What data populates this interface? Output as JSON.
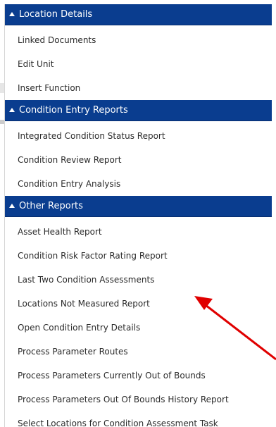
{
  "menu": {
    "sections": [
      {
        "title": "Location Details",
        "items": [
          "Linked Documents",
          "Edit Unit",
          "Insert Function"
        ]
      },
      {
        "title": "Condition Entry Reports",
        "items": [
          "Integrated Condition Status Report",
          "Condition Review Report",
          "Condition Entry Analysis"
        ]
      },
      {
        "title": "Other Reports",
        "items": [
          "Asset Health Report",
          "Condition Risk Factor Rating Report",
          "Last Two Condition Assessments",
          "Locations Not Measured Report",
          "Open Condition Entry Details",
          "Process Parameter Routes",
          "Process Parameters Currently Out of Bounds",
          "Process Parameters Out Of Bounds History Report",
          "Select Locations for Condition Assessment Task"
        ]
      }
    ]
  },
  "colors": {
    "header_bg": "#0a3d8f",
    "header_text": "#ffffff",
    "item_text": "#2b2b2b",
    "annotation_arrow": "#e00000"
  },
  "icons": {
    "section_toggle": "triangle-up-icon",
    "annotation": "red-arrow-icon"
  }
}
